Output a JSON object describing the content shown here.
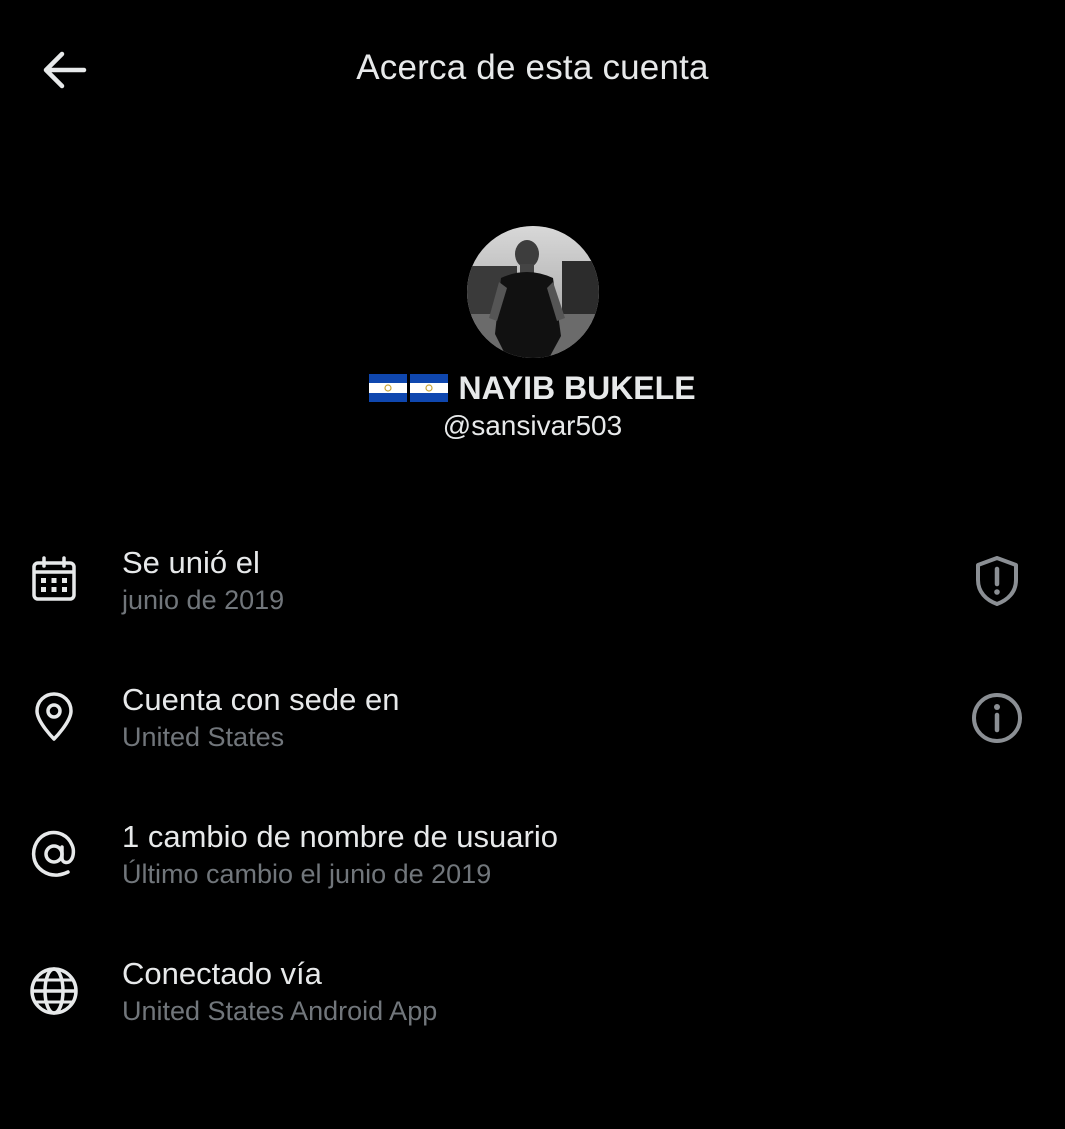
{
  "header": {
    "title": "Acerca de esta cuenta",
    "back_icon": "arrow-left-icon"
  },
  "profile": {
    "flag_icons": [
      "el-salvador-flag",
      "el-salvador-flag"
    ],
    "display_name": "NAYIB BUKELE",
    "handle": "@sansivar503"
  },
  "info": [
    {
      "icon": "calendar-icon",
      "title": "Se unió el",
      "subtitle": "junio de 2019",
      "action_icon": "shield-alert-icon"
    },
    {
      "icon": "location-pin-icon",
      "title": "Cuenta con sede en",
      "subtitle": "United States",
      "action_icon": "info-icon"
    },
    {
      "icon": "at-sign-icon",
      "title": "1 cambio de nombre de usuario",
      "subtitle": "Último cambio el junio de 2019"
    },
    {
      "icon": "globe-icon",
      "title": "Conectado vía",
      "subtitle": "United States Android App"
    }
  ],
  "colors": {
    "background": "#000000",
    "text_primary": "#e7e9ea",
    "text_secondary": "#71767b",
    "flag_blue": "#0f47af"
  }
}
